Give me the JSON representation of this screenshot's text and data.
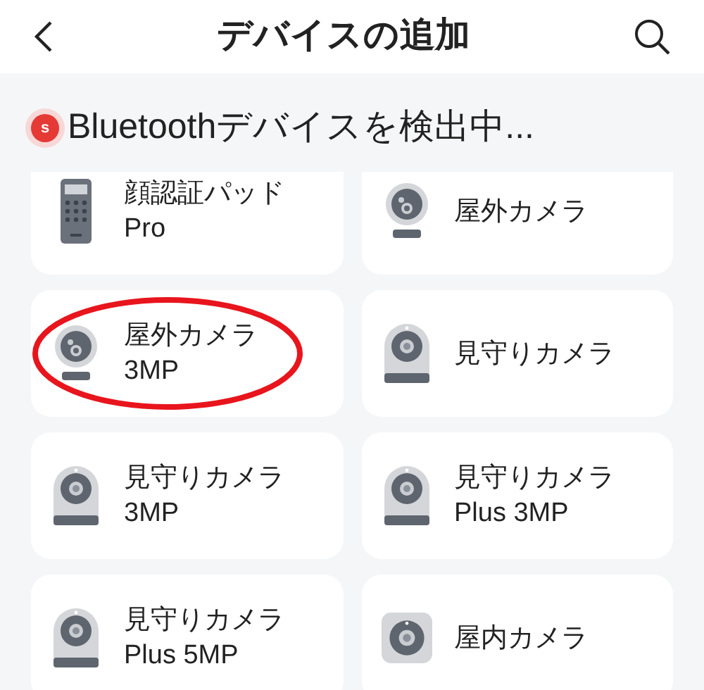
{
  "header": {
    "title": "デバイスの追加"
  },
  "scan_status": {
    "icon_letter": "s",
    "text": "Bluetoothデバイスを検出中..."
  },
  "devices": [
    {
      "kind": "keypad",
      "lines": [
        "顔認証パッド",
        "Pro"
      ],
      "circled": false
    },
    {
      "kind": "outdoor",
      "lines": [
        "屋外カメラ"
      ],
      "circled": false
    },
    {
      "kind": "outdoor",
      "lines": [
        "屋外カメラ",
        "3MP"
      ],
      "circled": true
    },
    {
      "kind": "dome",
      "lines": [
        "見守りカメラ"
      ],
      "circled": false
    },
    {
      "kind": "dome",
      "lines": [
        "見守りカメラ",
        "3MP"
      ],
      "circled": false
    },
    {
      "kind": "dome",
      "lines": [
        "見守りカメラ",
        "Plus 3MP"
      ],
      "circled": false
    },
    {
      "kind": "dome",
      "lines": [
        "見守りカメラ",
        "Plus 5MP"
      ],
      "circled": false
    },
    {
      "kind": "square",
      "lines": [
        "屋内カメラ"
      ],
      "circled": false
    }
  ]
}
